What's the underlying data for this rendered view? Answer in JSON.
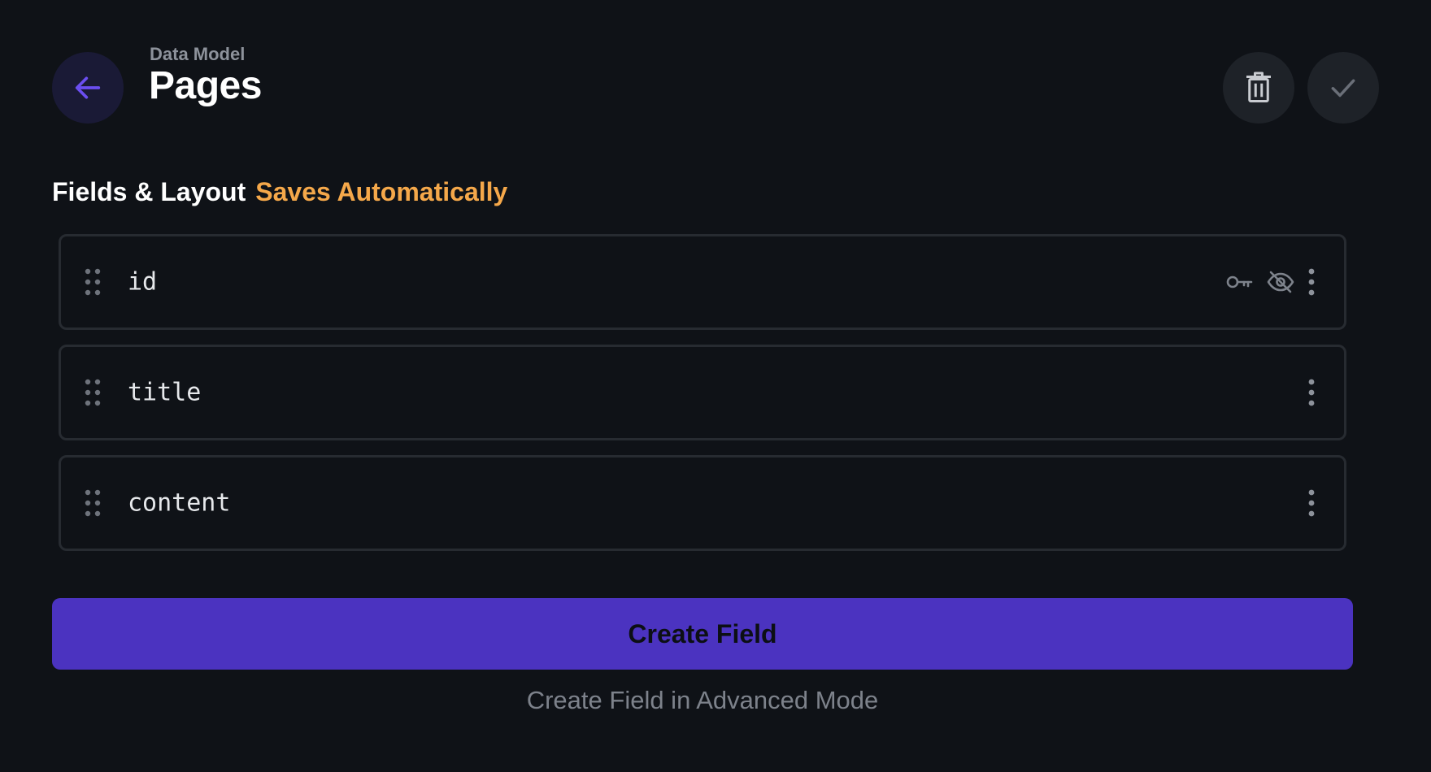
{
  "header": {
    "breadcrumb": "Data Model",
    "title": "Pages",
    "back_icon": "arrow-left-icon",
    "delete_icon": "trash-icon",
    "save_icon": "check-icon"
  },
  "section": {
    "label": "Fields & Layout",
    "status": "Saves Automatically"
  },
  "fields": [
    {
      "name": "id",
      "icons": [
        "key-icon",
        "eye-off-icon",
        "more-vertical-icon"
      ]
    },
    {
      "name": "title",
      "icons": [
        "more-vertical-icon"
      ]
    },
    {
      "name": "content",
      "icons": [
        "more-vertical-icon"
      ]
    }
  ],
  "actions": {
    "create_label": "Create Field",
    "advanced_label": "Create Field in Advanced Mode"
  },
  "colors": {
    "background": "#0f1217",
    "accent": "#4b33c0",
    "accent_icon": "#6b4ef0",
    "status": "#f5a84a",
    "muted": "#7d828b"
  }
}
